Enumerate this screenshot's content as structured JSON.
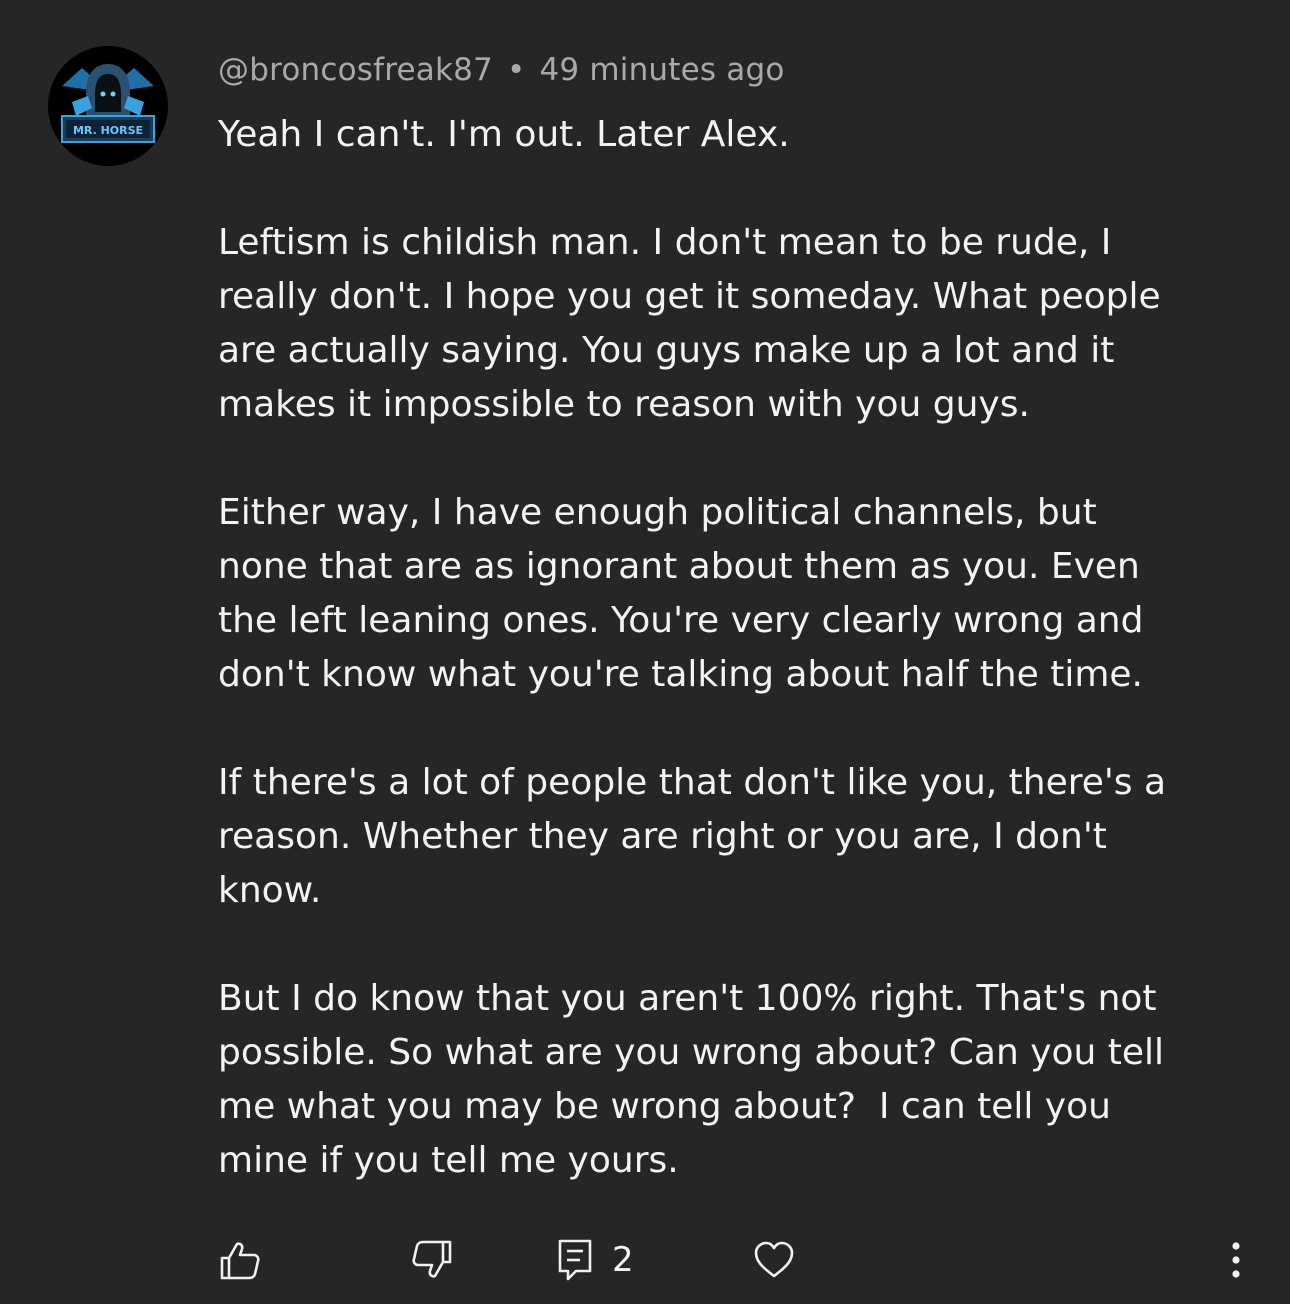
{
  "comment": {
    "author": "@broncosfreak87",
    "separator": "•",
    "timestamp": "49 minutes ago",
    "avatar_icon": "hooded-figure-logo-icon",
    "avatar_badge_text": "MR. HORSE",
    "paragraphs": [
      "Yeah I can't. I'm out. Later Alex.",
      "Leftism is childish man. I don't mean to be rude, I\nreally don't. I hope you get it someday. What people\nare actually saying. You guys make up a lot and it\nmakes it impossible to reason with you guys.",
      "Either way, I have enough political channels, but\nnone that are as ignorant about them as you. Even\nthe left leaning ones. You're very clearly wrong and\ndon't know what you're talking about half the time.",
      "If there's a lot of people that don't like you, there's a\nreason. Whether they are right or you are, I don't\nknow.",
      "But I do know that you aren't 100% right. That's not\npossible. So what are you wrong about? Can you tell\nme what you may be wrong about?  I can tell you\nmine if you tell me yours."
    ],
    "actions": {
      "like_icon": "thumbs-up-icon",
      "dislike_icon": "thumbs-down-icon",
      "reply_icon": "reply-comment-icon",
      "reply_count": "2",
      "heart_icon": "heart-icon",
      "more_icon": "more-vertical-icon"
    }
  },
  "colors": {
    "background": "#262626",
    "text": "#f3f3f3",
    "meta_text": "#a9a9a9",
    "avatar_accent": "#3aa0e0"
  }
}
